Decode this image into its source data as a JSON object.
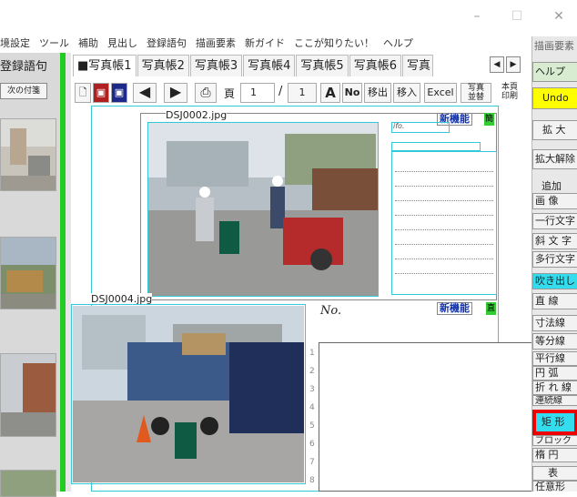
{
  "window": {
    "minimize": "–",
    "maximize": "☐",
    "close": "✕"
  },
  "menu": [
    "境設定",
    "ツール",
    "補助",
    "見出し",
    "登録語句",
    "描画要素",
    "新ガイド",
    "ここが知りたい！",
    "ヘルプ"
  ],
  "left_panel": {
    "label": "登録語句",
    "button": "次の付箋"
  },
  "tabs": [
    "■写真帳1",
    "写真帳2",
    "写真帳3",
    "写真帳4",
    "写真帳5",
    "写真帳6",
    "写真"
  ],
  "toolbar": {
    "page_label": "頁",
    "page_value": "1",
    "page_sep": "/",
    "page_total": "1",
    "font_a": "A",
    "no_btn": "No",
    "move_out": "移出",
    "move_in": "移入",
    "excel": "Excel",
    "photo_sort": "写真並替",
    "page_print": "本頁印刷"
  },
  "page": {
    "file1": "DSJ0002.jpg",
    "file2": "DSJ0004.jpg",
    "new_feature": "新機能",
    "box_label": "簡",
    "box_label2": "直",
    "no_label": "No.",
    "small_label": "ifo.",
    "line_numbers": [
      "1",
      "2",
      "3",
      "4",
      "5",
      "6",
      "7",
      "8"
    ]
  },
  "right_panel": {
    "title": "描画要素",
    "items": [
      "ヘルプ",
      "Undo",
      "拡 大",
      "拡大解除",
      "追加",
      "画 像",
      "一行文字",
      "斜 文 字",
      "多行文字",
      "吹き出し",
      "直 線",
      "寸法線",
      "等分線",
      "平行線",
      "円 弧",
      "折 れ 線",
      "連続線",
      "矩 形",
      "ブロック",
      "楕 円",
      "表",
      "任意形"
    ]
  },
  "colors": {
    "accent_green": "#22cc22",
    "cyan_border": "#33c9d9",
    "undo_bg": "#ffff00",
    "fukidashi_bg": "#33ddee",
    "kukei_bg": "#33ddee",
    "highlight_red": "#ee0000"
  }
}
